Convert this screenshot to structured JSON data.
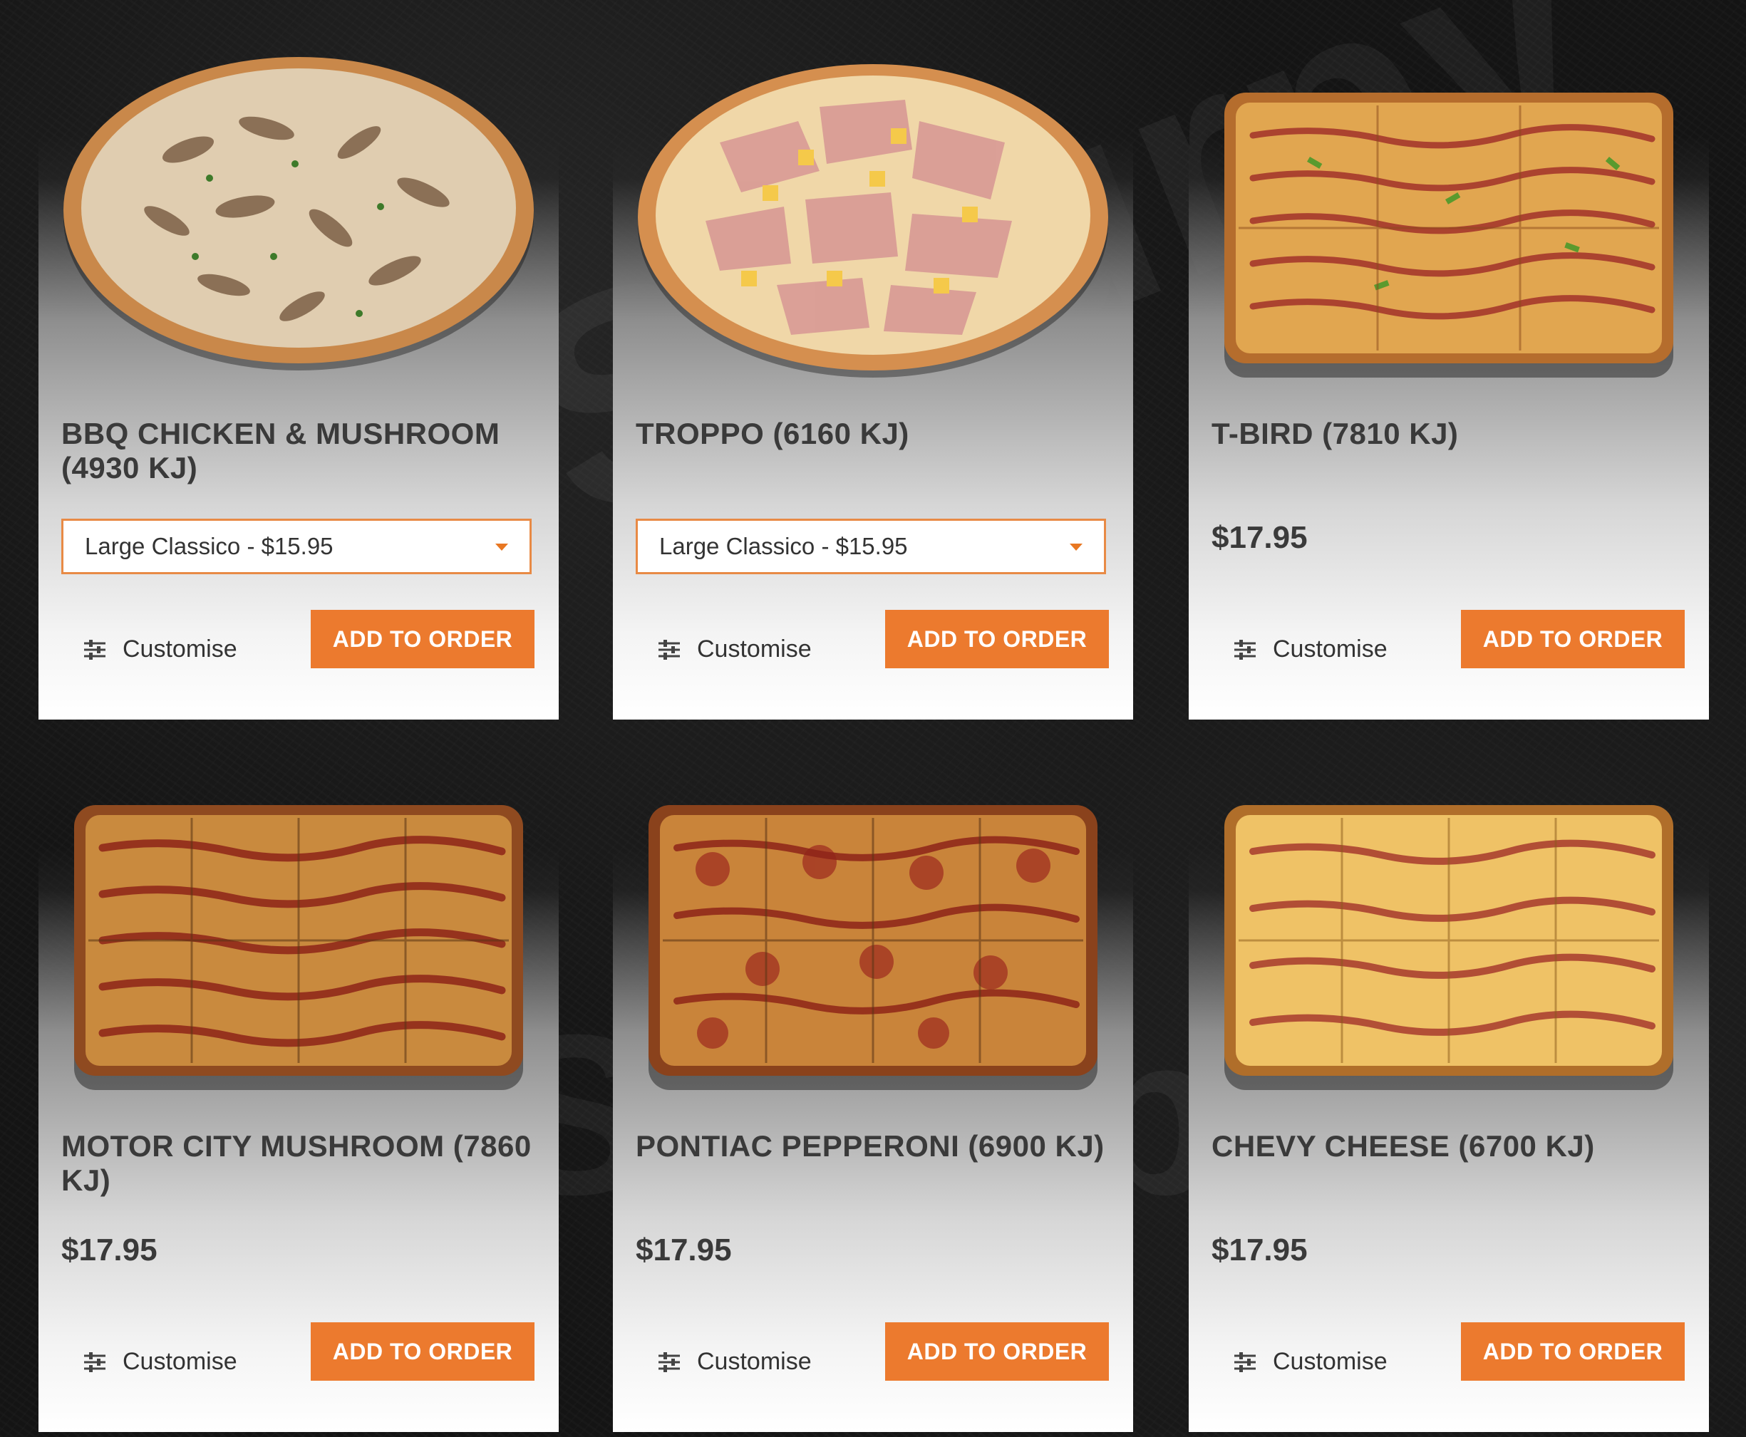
{
  "watermark": "Sluurpy",
  "colors": {
    "accent_orange": "#ec7a2e",
    "select_border": "#e88a45",
    "title_text": "#3a3a3a",
    "background": "#141414"
  },
  "pizzas": [
    {
      "name": "BBQ Chicken & Mushroom (4930 KJ)",
      "size_select": "Large Classico - $15.95",
      "customise_label": "Customise",
      "add_label": "Add to order",
      "image_icon": "round-pizza-image"
    },
    {
      "name": "Troppo (6160 KJ)",
      "size_select": "Large Classico - $15.95",
      "customise_label": "Customise",
      "add_label": "Add to order",
      "image_icon": "round-pizza-image"
    },
    {
      "name": "T-Bird (7810 KJ)",
      "price": "$17.95",
      "customise_label": "Customise",
      "add_label": "Add to order",
      "image_icon": "square-pizza-image"
    },
    {
      "name": "Motor City Mushroom (7860 KJ)",
      "price": "$17.95",
      "customise_label": "Customise",
      "add_label": "Add to order",
      "image_icon": "square-pizza-image"
    },
    {
      "name": "Pontiac Pepperoni (6900 KJ)",
      "price": "$17.95",
      "customise_label": "Customise",
      "add_label": "Add to order",
      "image_icon": "square-pizza-image"
    },
    {
      "name": "Chevy Cheese (6700 KJ)",
      "price": "$17.95",
      "customise_label": "Customise",
      "add_label": "Add to order",
      "image_icon": "square-pizza-image"
    }
  ]
}
